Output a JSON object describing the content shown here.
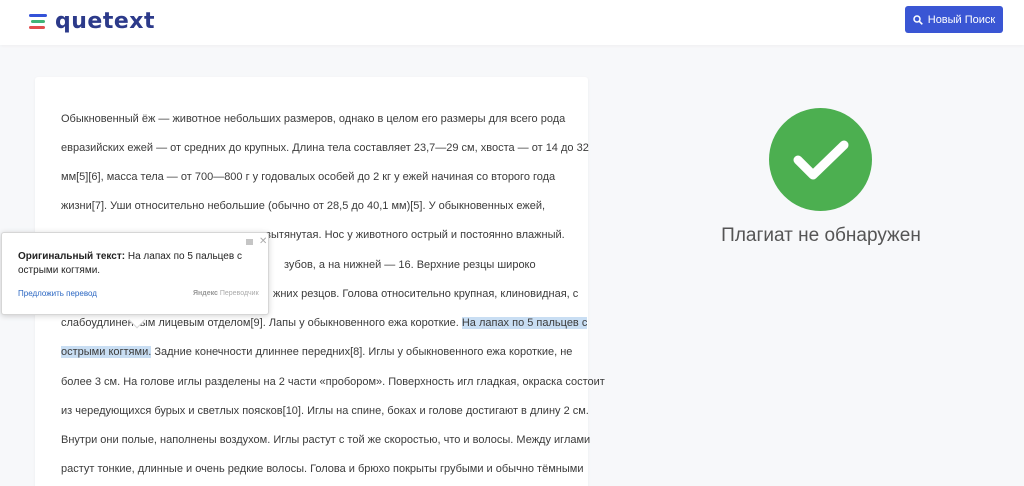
{
  "header": {
    "logo_text": "quetext",
    "new_search_label": "Новый Поиск"
  },
  "document": {
    "lines": [
      {
        "text": "Обыкновенный ёж — животное небольших размеров, однако в целом его размеры для всего рода"
      },
      {
        "text": "евразийских ежей — от средних до крупных. Длина тела составляет 23,7—29 см, хвоста — от 14 до 32"
      },
      {
        "text": "мм[5][6], масса тела — от 700—800 г у годовалых особей до 2 кг у ежей начиная со второго года"
      },
      {
        "text": "жизни[7]. Уши относительно небольшие (обычно от 28,5 до 40,1 мм)[5]. У обыкновенных ежей,"
      },
      {
        "text": "а вытянутая. Нос у животного острый и постоянно влажный."
      },
      {
        "text": "зубов, а на нижней — 16. Верхние резцы широко"
      },
      {
        "text": "жних резцов. Голова относительно крупная, клиновидная, с"
      },
      {
        "text": "слабоудлиненным лицевым отделом[9]. Лапы у обыкновенного ежа короткие.",
        "highlight": "На лапах по 5 пальцев с"
      },
      {
        "highlight_start": "острыми когтями.",
        "text": " Задние конечности длиннее передних[8]. Иглы у обыкновенного ежа короткие, не"
      },
      {
        "text": "более 3 см. На голове иглы разделены на 2 части «пробором». Поверхность игл гладкая, окраска состоит"
      },
      {
        "text": "из чередующихся бурых и светлых поясков[10]. Иглы на спине, боках и голове достигают в длину 2 см."
      },
      {
        "text": "Внутри они полые, наполнены воздухом. Иглы растут с той же скоростью, что и волосы. Между иглами"
      },
      {
        "text": "растут тонкие, длинные и очень редкие волосы. Голова и брюхо покрыты грубыми и обычно тёмными"
      }
    ]
  },
  "result": {
    "status_text": "Плагиат не обнаружен",
    "status_color": "#4caf50"
  },
  "translate_popup": {
    "label": "Оригинальный текст:",
    "original": " На лапах по 5 пальцев с острыми когтями.",
    "suggest_link": "Предложить перевод",
    "brand_bold": "Яндекс",
    "brand": " Переводчик"
  }
}
